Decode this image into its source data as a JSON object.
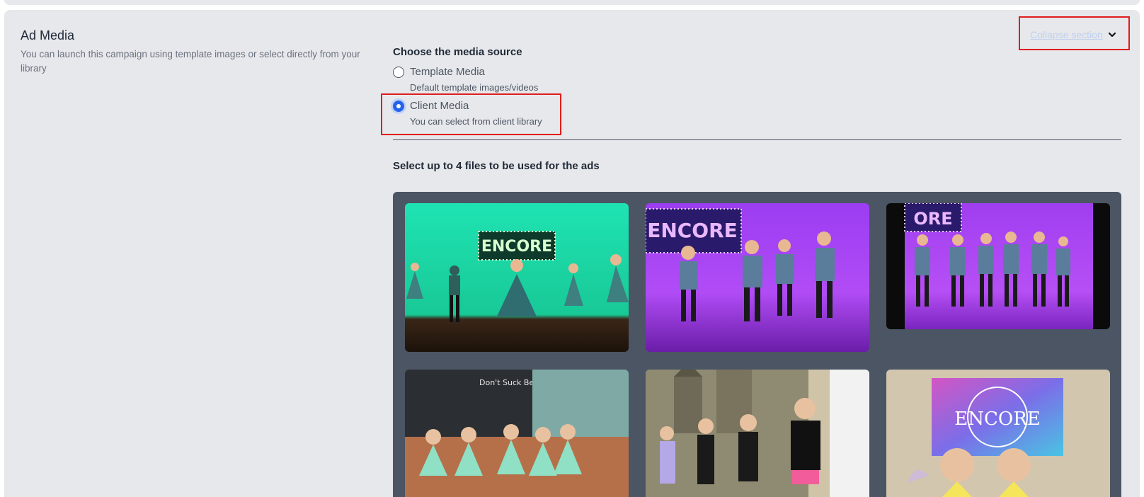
{
  "section": {
    "title": "Ad Media",
    "description": "You can launch this campaign using template images or select directly from your library",
    "collapse_label": "Collapse section"
  },
  "media_source": {
    "label": "Choose the media source",
    "options": [
      {
        "label": "Template Media",
        "description": "Default template images/videos",
        "selected": false
      },
      {
        "label": "Client Media",
        "description": "You can select from client library",
        "selected": true
      }
    ]
  },
  "files": {
    "label": "Select up to 4 files to be used for the ads",
    "items": [
      {
        "sign_text": "ENCORE",
        "scene": "dancers on green stage"
      },
      {
        "sign_text": "ENCORE",
        "scene": "dancers on purple stage"
      },
      {
        "sign_text": "ORE",
        "scene": "dancers in a line on purple stage"
      },
      {
        "sign_text": "Don't Suck Be Brave DANCE!",
        "scene": "girls in mint tutus"
      },
      {
        "sign_text": "",
        "scene": "girls in front of castle backdrop"
      },
      {
        "sign_text": "ENCORE",
        "scene": "girls in yellow costumes"
      }
    ]
  },
  "colors": {
    "accent": "#2563eb",
    "highlight": "#e11d1d",
    "gallery_bg": "#4b5563"
  }
}
